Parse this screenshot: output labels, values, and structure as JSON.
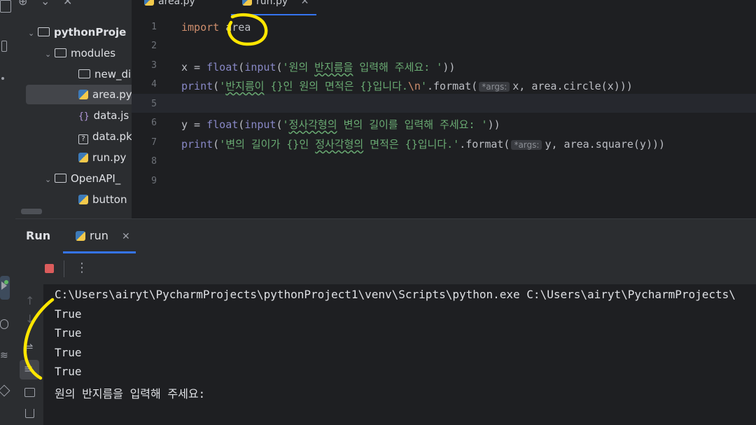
{
  "tabs": [
    {
      "label": "area.py"
    },
    {
      "label": "run.py"
    }
  ],
  "project_tree": {
    "items": [
      {
        "label": "pythonProje",
        "kind": "folder",
        "expanded": true
      },
      {
        "label": "modules",
        "kind": "folder",
        "expanded": true
      },
      {
        "label": "new_di",
        "kind": "folder"
      },
      {
        "label": "area.py",
        "kind": "python",
        "selected": true
      },
      {
        "label": "data.js",
        "kind": "json"
      },
      {
        "label": "data.pk",
        "kind": "unknown"
      },
      {
        "label": "run.py",
        "kind": "python"
      },
      {
        "label": "OpenAPI_",
        "kind": "folder",
        "expanded": true
      },
      {
        "label": "button",
        "kind": "python"
      }
    ]
  },
  "editor": {
    "line_numbers": [
      "1",
      "2",
      "3",
      "4",
      "5",
      "6",
      "7",
      "8",
      "9"
    ],
    "line1": {
      "kw": "import",
      "mod": "area"
    },
    "line3": {
      "a": "x = ",
      "f": "float",
      "b": "(",
      "i": "input",
      "c": "(",
      "s1": "'원의 ",
      "s2": "반지름을",
      "s3": " 입력해 주세요: '",
      "d": "))"
    },
    "line4": {
      "p": "print",
      "a": "(",
      "s1": "'",
      "s2": "반지름이",
      "s3": " {}인 원의 면적은 {}입니다.",
      "e": "\\n",
      "s4": "'",
      "b": ".format(",
      "hint": "*args:",
      "c": "x, area.circle(x)))"
    },
    "line6": {
      "a": "y = ",
      "f": "float",
      "b": "(",
      "i": "input",
      "c": "(",
      "s1": "'",
      "s2": "정사각형의",
      "s3": " 변의 길이를 입력해 주세요: '",
      "d": "))"
    },
    "line7": {
      "p": "print",
      "a": "(",
      "s1": "'변의 길이가 {}인 ",
      "s2": "정사각형의",
      "s3": " 면적은 {}입니다.'",
      "b": ".format(",
      "hint": "*args:",
      "c": "y, area.square(y)))"
    }
  },
  "run_panel": {
    "title": "Run",
    "tab_label": "run",
    "console_lines": [
      "C:\\Users\\airyt\\PycharmProjects\\pythonProject1\\venv\\Scripts\\python.exe C:\\Users\\airyt\\PycharmProjects\\",
      "True",
      "True",
      "True",
      "True",
      "원의 반지름을 입력해 주세요:"
    ]
  },
  "colors": {
    "accent": "#3574f0",
    "annotation": "#ffe600",
    "stop": "#db5c5c",
    "rerun": "#5fb865"
  }
}
